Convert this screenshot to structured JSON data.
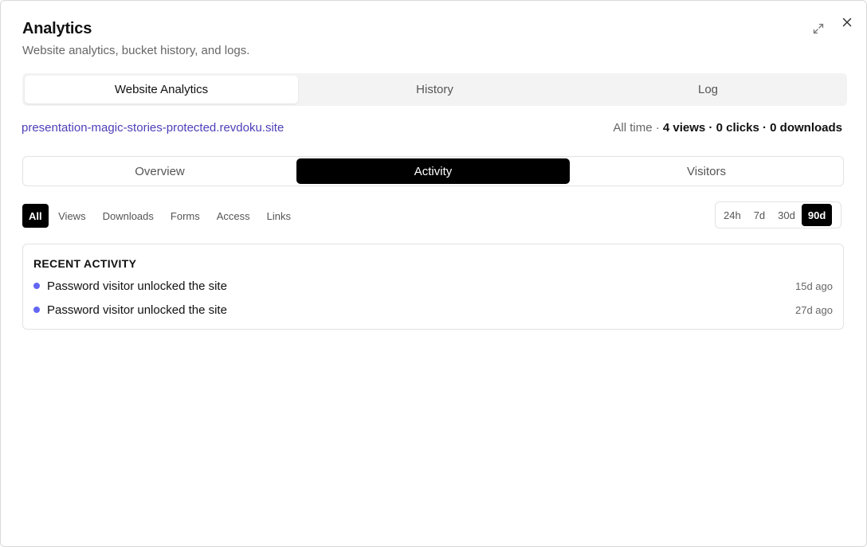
{
  "dialog": {
    "title": "Analytics",
    "subtitle": "Website analytics, bucket history, and logs."
  },
  "icons": {
    "expand": "expand-icon",
    "close": "close-icon"
  },
  "main_tabs": [
    {
      "label": "Website Analytics",
      "active": true
    },
    {
      "label": "History",
      "active": false
    },
    {
      "label": "Log",
      "active": false
    }
  ],
  "site": {
    "url": "presentation-magic-stories-protected.revdoku.site"
  },
  "stats": {
    "range_label": "All time ·",
    "views": "4 views",
    "clicks": "0 clicks",
    "downloads": "0 downloads",
    "separator": " · "
  },
  "sub_tabs": [
    {
      "label": "Overview",
      "active": false
    },
    {
      "label": "Activity",
      "active": true
    },
    {
      "label": "Visitors",
      "active": false
    }
  ],
  "filters": [
    {
      "label": "All",
      "active": true
    },
    {
      "label": "Views",
      "active": false
    },
    {
      "label": "Downloads",
      "active": false
    },
    {
      "label": "Forms",
      "active": false
    },
    {
      "label": "Access",
      "active": false
    },
    {
      "label": "Links",
      "active": false
    }
  ],
  "time_ranges": [
    {
      "label": "24h",
      "active": false
    },
    {
      "label": "7d",
      "active": false
    },
    {
      "label": "30d",
      "active": false
    },
    {
      "label": "90d",
      "active": true
    }
  ],
  "recent_activity": {
    "title": "RECENT ACTIVITY",
    "items": [
      {
        "text": "Password visitor unlocked the site",
        "time": "15d ago"
      },
      {
        "text": "Password visitor unlocked the site",
        "time": "27d ago"
      }
    ]
  },
  "colors": {
    "accent": "#4b3fb8",
    "dot": "#6366f1",
    "active_bg": "#000000"
  }
}
